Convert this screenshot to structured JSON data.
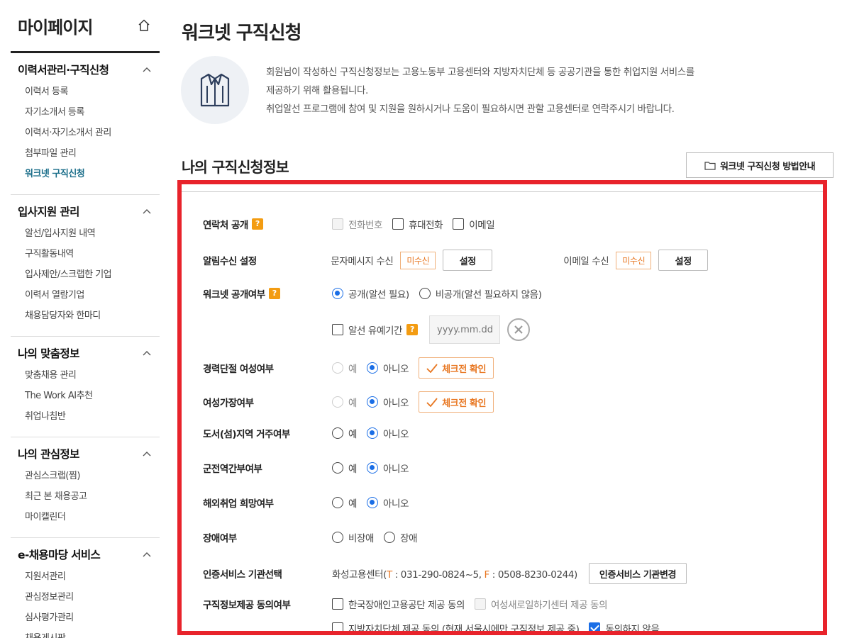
{
  "sidebar": {
    "title": "마이페이지",
    "sections": [
      {
        "heading": "이력서관리·구직신청",
        "items": [
          "이력서 등록",
          "자기소개서 등록",
          "이력서·자기소개서 관리",
          "첨부파일 관리",
          "워크넷 구직신청"
        ]
      },
      {
        "heading": "입사지원 관리",
        "items": [
          "알선/입사지원 내역",
          "구직활동내역",
          "입사제안/스크랩한 기업",
          "이력서 열람기업",
          "채용담당자와 한마디"
        ]
      },
      {
        "heading": "나의 맞춤정보",
        "items": [
          "맞춤채용 관리",
          "The Work AI추천",
          "취업나침반"
        ]
      },
      {
        "heading": "나의 관심정보",
        "items": [
          "관심스크랩(찜)",
          "최근 본 채용공고",
          "마이캘린더"
        ]
      },
      {
        "heading": "e-채용마당 서비스",
        "items": [
          "지원서관리",
          "관심정보관리",
          "심사평가관리",
          "채용게시판"
        ]
      }
    ]
  },
  "page": {
    "title": "워크넷 구직신청",
    "intro_lines": [
      "회원님이 작성하신 구직신청정보는 고용노동부 고용센터와 지방자치단체 등 공공기관을 통한 취업지원 서비스를",
      "제공하기 위해 활용됩니다.",
      "취업알선 프로그램에 참여 및 지원을 원하시거나 도움이 필요하시면 관할 고용센터로 연락주시기 바랍니다."
    ],
    "section_title": "나의 구직신청정보",
    "guide_button": "워크넷 구직신청 방법안내"
  },
  "form": {
    "contact": {
      "label": "연락처 공개",
      "q": "?",
      "options": [
        "전화번호",
        "휴대전화",
        "이메일"
      ]
    },
    "notify": {
      "label": "알림수신 설정",
      "sms_label": "문자메시지 수신",
      "sms_status": "미수신",
      "sms_button": "설정",
      "email_label": "이메일 수신",
      "email_status": "미수신",
      "email_button": "설정"
    },
    "worknet_public": {
      "label": "워크넷 공개여부",
      "q": "?",
      "options": [
        "공개(알선 필요)",
        "비공개(알선 필요하지 않음)"
      ],
      "grace_label": "알선 유예기간",
      "grace_q": "?",
      "date_placeholder": "yyyy.mm.dd"
    },
    "career_break": {
      "label": "경력단절 여성여부",
      "options": [
        "예",
        "아니오"
      ],
      "check_button": "체크전 확인"
    },
    "female_head": {
      "label": "여성가장여부",
      "options": [
        "예",
        "아니오"
      ],
      "check_button": "체크전 확인"
    },
    "island": {
      "label": "도서(섬)지역 거주여부",
      "options": [
        "예",
        "아니오"
      ]
    },
    "military": {
      "label": "군전역간부여부",
      "options": [
        "예",
        "아니오"
      ]
    },
    "overseas": {
      "label": "해외취업 희망여부",
      "options": [
        "예",
        "아니오"
      ]
    },
    "disability": {
      "label": "장애여부",
      "options": [
        "비장애",
        "장애"
      ]
    },
    "cert": {
      "label": "인증서비스 기관선택",
      "center": "화성고용센터(",
      "t_key": "T",
      "t_val": " : 031-290-0824~5, ",
      "f_key": "F",
      "f_val": " : 0508-8230-0244)",
      "button": "인증서비스 기관변경"
    },
    "consent": {
      "label": "구직정보제공 동의여부",
      "options": [
        "한국장애인고용공단 제공 동의",
        "여성새로일하기센터 제공 동의",
        "지방자치단체 제공 동의 (현재 서울시에만 구직정보 제공 중)",
        "동의하지 않음"
      ]
    }
  }
}
